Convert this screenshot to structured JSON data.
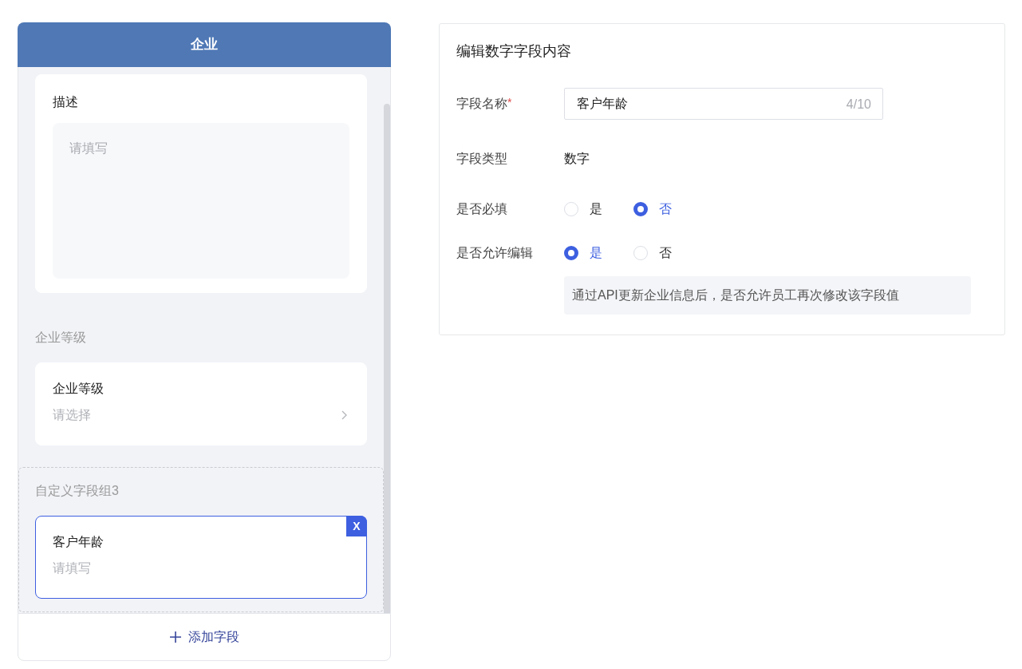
{
  "left_panel": {
    "title": "企业",
    "sections": [
      {
        "kind": "field",
        "field": {
          "label": "描述",
          "kind": "textarea",
          "placeholder": "请填写",
          "selected": false
        }
      },
      {
        "kind": "group",
        "title": "企业等级",
        "selected": false,
        "fields": [
          {
            "label": "企业等级",
            "kind": "select",
            "placeholder": "请选择",
            "selected": false
          }
        ]
      },
      {
        "kind": "group",
        "title": "自定义字段组3",
        "selected": true,
        "fields": [
          {
            "label": "客户年龄",
            "kind": "text",
            "placeholder": "请填写",
            "selected": true,
            "delete_label": "X"
          }
        ]
      }
    ],
    "add_button": {
      "label": "添加字段"
    }
  },
  "editor": {
    "title": "编辑数字字段内容",
    "rows": [
      {
        "kind": "input",
        "label": "字段名称",
        "required_mark": "*",
        "value": "客户年龄",
        "counter": "4/10"
      },
      {
        "kind": "text",
        "label": "字段类型",
        "value": "数字"
      },
      {
        "kind": "radio",
        "label": "是否必填",
        "options": [
          {
            "label": "是",
            "selected": false
          },
          {
            "label": "否",
            "selected": true
          }
        ]
      },
      {
        "kind": "radio",
        "label": "是否允许编辑",
        "options": [
          {
            "label": "是",
            "selected": true
          },
          {
            "label": "否",
            "selected": false
          }
        ],
        "hint": "通过API更新企业信息后，是否允许员工再次修改该字段值"
      }
    ]
  }
}
